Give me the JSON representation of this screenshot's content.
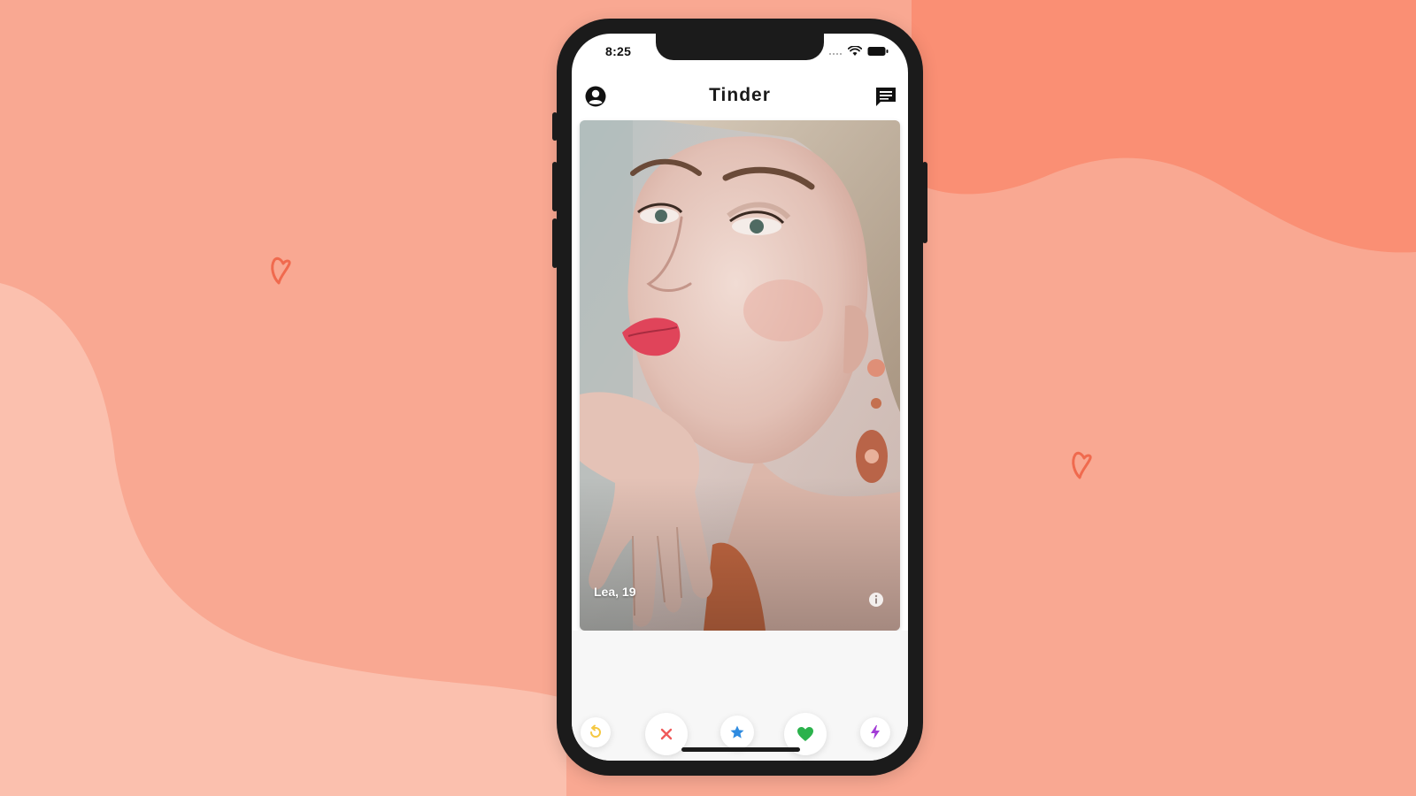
{
  "status_bar": {
    "time": "8:25",
    "icons": [
      "signal-icon",
      "wifi-icon",
      "battery-icon"
    ]
  },
  "header": {
    "title": "Tinder",
    "left_icon": "account-circle-icon",
    "right_icon": "chat-icon"
  },
  "card": {
    "name_age": "Lea, 19",
    "info_icon": "info-icon"
  },
  "actions": [
    {
      "name": "rewind",
      "icon": "rewind-icon",
      "color": "#f5c842"
    },
    {
      "name": "nope",
      "icon": "close-icon",
      "color": "#f05a5a"
    },
    {
      "name": "super-like",
      "icon": "star-icon",
      "color": "#2f8be0"
    },
    {
      "name": "like",
      "icon": "heart-icon",
      "color": "#2bb24c"
    },
    {
      "name": "boost",
      "icon": "lightning-icon",
      "color": "#a23bd6"
    }
  ],
  "colors": {
    "background": "#f8a68f",
    "background_light": "#fbc2b1",
    "background_dark": "#fa8f73",
    "heart_decoration": "#f06a4e"
  }
}
